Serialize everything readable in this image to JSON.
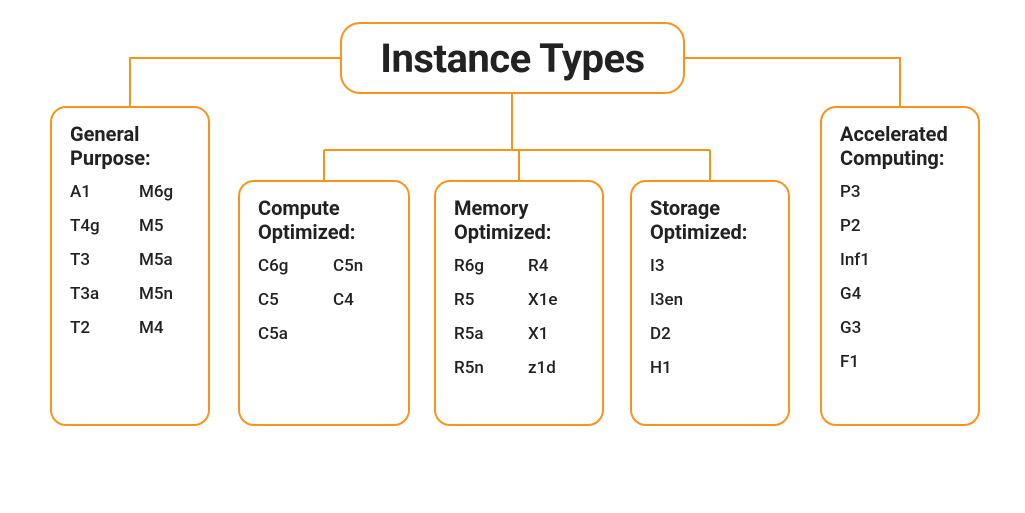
{
  "root": {
    "title": "Instance Types"
  },
  "general": {
    "title": "General Purpose:",
    "items": [
      "A1",
      "M6g",
      "T4g",
      "M5",
      "T3",
      "M5a",
      "T3a",
      "M5n",
      "T2",
      "M4"
    ]
  },
  "compute": {
    "title": "Compute Optimized:",
    "items": [
      "C6g",
      "C5n",
      "C5",
      "C4",
      "C5a",
      ""
    ]
  },
  "memory": {
    "title": "Memory Optimized:",
    "items": [
      "R6g",
      "R4",
      "R5",
      "X1e",
      "R5a",
      "X1",
      "R5n",
      "z1d"
    ]
  },
  "storage": {
    "title": "Storage Optimized:",
    "items": [
      "I3",
      "I3en",
      "D2",
      "H1"
    ]
  },
  "accel": {
    "title": "Accelerated Computing:",
    "items": [
      "P3",
      "P2",
      "Inf1",
      "G4",
      "G3",
      "F1"
    ]
  },
  "colors": {
    "stroke": "#f7941d"
  }
}
